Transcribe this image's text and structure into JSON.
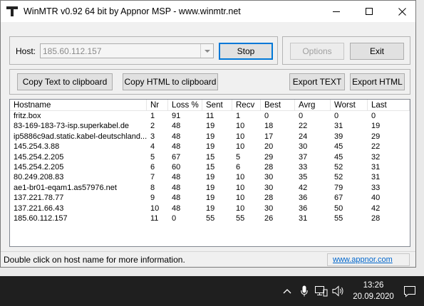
{
  "window": {
    "title": "WinMTR v0.92 64 bit by Appnor MSP - www.winmtr.net"
  },
  "host_group": {
    "label": "Host:",
    "value": "185.60.112.157",
    "stop_label": "Stop"
  },
  "control_group": {
    "options_label": "Options",
    "exit_label": "Exit"
  },
  "export_group": {
    "copy_text_label": "Copy Text to clipboard",
    "copy_html_label": "Copy HTML to clipboard",
    "export_text_label": "Export TEXT",
    "export_html_label": "Export HTML"
  },
  "table": {
    "columns": [
      "Hostname",
      "Nr",
      "Loss %",
      "Sent",
      "Recv",
      "Best",
      "Avrg",
      "Worst",
      "Last"
    ],
    "rows": [
      [
        "fritz.box",
        "1",
        "91",
        "11",
        "1",
        "0",
        "0",
        "0",
        "0"
      ],
      [
        "83-169-183-73-isp.superkabel.de",
        "2",
        "48",
        "19",
        "10",
        "18",
        "22",
        "31",
        "19"
      ],
      [
        "ip5886c9ad.static.kabel-deutschland....",
        "3",
        "48",
        "19",
        "10",
        "17",
        "24",
        "39",
        "29"
      ],
      [
        "145.254.3.88",
        "4",
        "48",
        "19",
        "10",
        "20",
        "30",
        "45",
        "22"
      ],
      [
        "145.254.2.205",
        "5",
        "67",
        "15",
        "5",
        "29",
        "37",
        "45",
        "32"
      ],
      [
        "145.254.2.205",
        "6",
        "60",
        "15",
        "6",
        "28",
        "33",
        "52",
        "31"
      ],
      [
        "80.249.208.83",
        "7",
        "48",
        "19",
        "10",
        "30",
        "35",
        "52",
        "31"
      ],
      [
        "ae1-br01-eqam1.as57976.net",
        "8",
        "48",
        "19",
        "10",
        "30",
        "42",
        "79",
        "33"
      ],
      [
        "137.221.78.77",
        "9",
        "48",
        "19",
        "10",
        "28",
        "36",
        "67",
        "40"
      ],
      [
        "137.221.66.43",
        "10",
        "48",
        "19",
        "10",
        "30",
        "36",
        "50",
        "42"
      ],
      [
        "185.60.112.157",
        "11",
        "0",
        "55",
        "55",
        "26",
        "31",
        "55",
        "28"
      ]
    ]
  },
  "statusbar": {
    "text": "Double click on host name for more information.",
    "link": "www.appnor.com"
  },
  "taskbar": {
    "time": "13:26",
    "date": "20.09.2020"
  }
}
